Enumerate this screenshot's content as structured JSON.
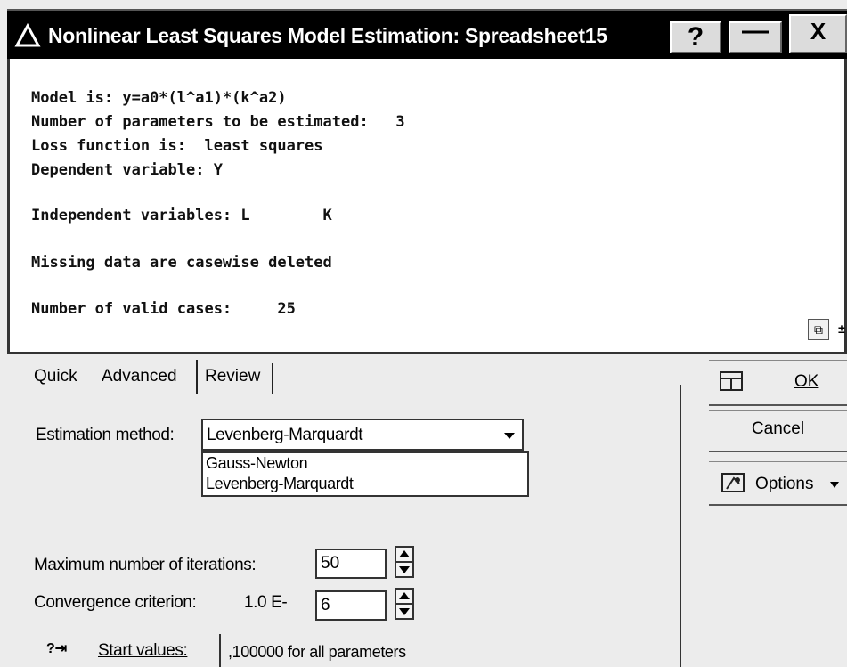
{
  "window": {
    "title": "Nonlinear Least Squares Model Estimation: Spreadsheet15",
    "help_label": "?",
    "minimize_label": "—",
    "close_label": "X"
  },
  "results": {
    "lines": [
      "Model is: y=a0*(l^a1)*(k^a2)",
      "Number of parameters to be estimated:   3",
      "Loss function is:  least squares",
      "Dependent variable: Y",
      "Independent variables: L        K",
      "Missing data are casewise deleted",
      "Number of valid cases:     25"
    ]
  },
  "tabs": [
    {
      "label": "Quick",
      "active": false
    },
    {
      "label": "Advanced",
      "active": true
    },
    {
      "label": "Review",
      "active": false
    }
  ],
  "estimation": {
    "label": "Estimation method:",
    "selected": "Levenberg-Marquardt",
    "options": [
      "Gauss-Newton",
      "Levenberg-Marquardt"
    ]
  },
  "iterations": {
    "label": "Maximum number of iterations:",
    "value": "50"
  },
  "convergence": {
    "label": "Convergence criterion:",
    "prefix": "1.0 E-",
    "value": "6"
  },
  "start_values": {
    "label": "Start values:",
    "value": ",100000 for all parameters"
  },
  "buttons": {
    "ok": "OK",
    "cancel": "Cancel",
    "options": "Options"
  }
}
